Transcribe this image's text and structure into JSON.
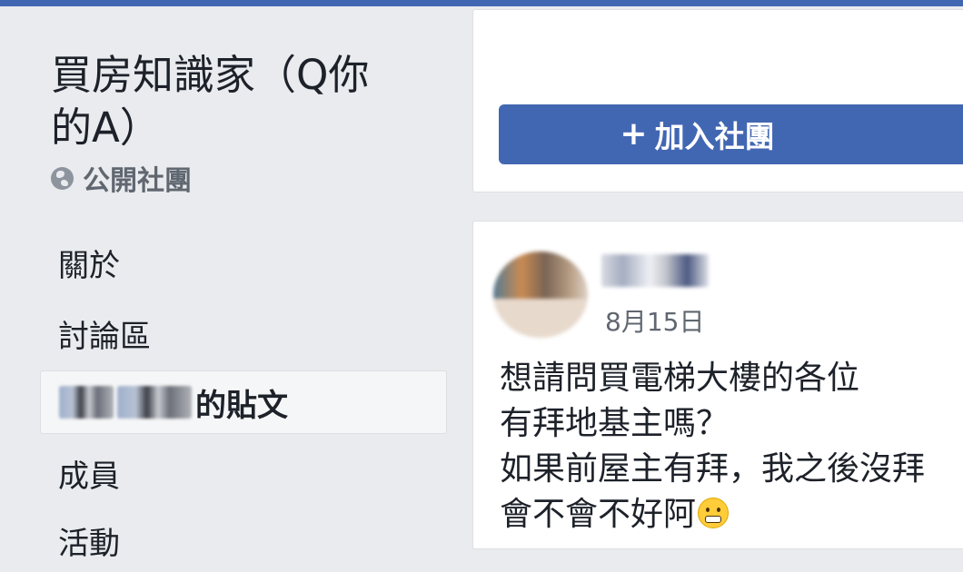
{
  "group": {
    "title_line1": "買房知識家（Q你",
    "title_line2": "的A）",
    "privacy_icon": "globe-icon",
    "privacy_label": "公開社團"
  },
  "nav": {
    "about": "關於",
    "discussion": "討論區",
    "my_posts_suffix": "的貼文",
    "members": "成員",
    "events_partial": "活動"
  },
  "join": {
    "plus": "+",
    "label": "加入社團"
  },
  "post": {
    "date": "8月15日",
    "lines": [
      "想請問買電梯大樓的各位",
      "有拜地基主嗎？",
      "如果前屋主有拜，我之後沒拜",
      "會不會不好阿"
    ],
    "emoji": "grimacing-face-emoji"
  },
  "colors": {
    "brand": "#4267b2",
    "background": "#e9ebee"
  }
}
